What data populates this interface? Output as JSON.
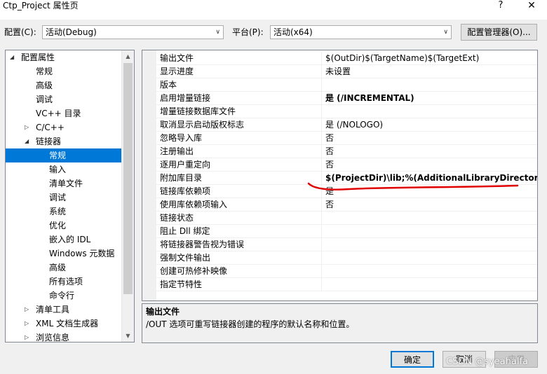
{
  "window": {
    "title": "Ctp_Project 属性页",
    "help": "?",
    "close": "✕"
  },
  "toolbar": {
    "config_label": "配置(C):",
    "config_value": "活动(Debug)",
    "platform_label": "平台(P):",
    "platform_value": "活动(x64)",
    "config_manager_label": "配置管理器(O)..."
  },
  "tree": {
    "items": [
      {
        "label": "配置属性",
        "glyph": "◢"
      },
      {
        "label": "常规"
      },
      {
        "label": "高级"
      },
      {
        "label": "调试"
      },
      {
        "label": "VC++ 目录"
      },
      {
        "label": "C/C++",
        "glyph": "▷"
      },
      {
        "label": "链接器",
        "glyph": "◢"
      },
      {
        "label": "常规",
        "selected": true
      },
      {
        "label": "输入"
      },
      {
        "label": "清单文件"
      },
      {
        "label": "调试"
      },
      {
        "label": "系统"
      },
      {
        "label": "优化"
      },
      {
        "label": "嵌入的 IDL"
      },
      {
        "label": "Windows 元数据"
      },
      {
        "label": "高级"
      },
      {
        "label": "所有选项"
      },
      {
        "label": "命令行"
      },
      {
        "label": "清单工具",
        "glyph": "▷"
      },
      {
        "label": "XML 文档生成器",
        "glyph": "▷"
      },
      {
        "label": "浏览信息",
        "glyph": "▷"
      }
    ]
  },
  "properties": [
    {
      "name": "输出文件",
      "value": "$(OutDir)$(TargetName)$(TargetExt)"
    },
    {
      "name": "显示进度",
      "value": "未设置"
    },
    {
      "name": "版本",
      "value": ""
    },
    {
      "name": "启用增量链接",
      "value": "是 (/INCREMENTAL)",
      "bold": true
    },
    {
      "name": "增量链接数据库文件",
      "value": ""
    },
    {
      "name": "取消显示启动版权标志",
      "value": "是 (/NOLOGO)"
    },
    {
      "name": "忽略导入库",
      "value": "否"
    },
    {
      "name": "注册输出",
      "value": "否"
    },
    {
      "name": "逐用户重定向",
      "value": "否"
    },
    {
      "name": "附加库目录",
      "value": "$(ProjectDir)\\lib;%(AdditionalLibraryDirectories)",
      "bold": true
    },
    {
      "name": "链接库依赖项",
      "value": "是"
    },
    {
      "name": "使用库依赖项输入",
      "value": "否"
    },
    {
      "name": "链接状态",
      "value": ""
    },
    {
      "name": "阻止 Dll 绑定",
      "value": ""
    },
    {
      "name": "将链接器警告视为错误",
      "value": ""
    },
    {
      "name": "强制文件输出",
      "value": ""
    },
    {
      "name": "创建可热修补映像",
      "value": ""
    },
    {
      "name": "指定节特性",
      "value": ""
    }
  ],
  "description": {
    "title": "输出文件",
    "body": "/OUT 选项可重写链接器创建的程序的默认名称和位置。"
  },
  "buttons": {
    "ok": "确定",
    "cancel": "取消",
    "apply": "应用"
  },
  "watermark": "CSDN @syeahalfa",
  "colors": {
    "selection": "#0078d7",
    "annotation": "#e00000"
  }
}
